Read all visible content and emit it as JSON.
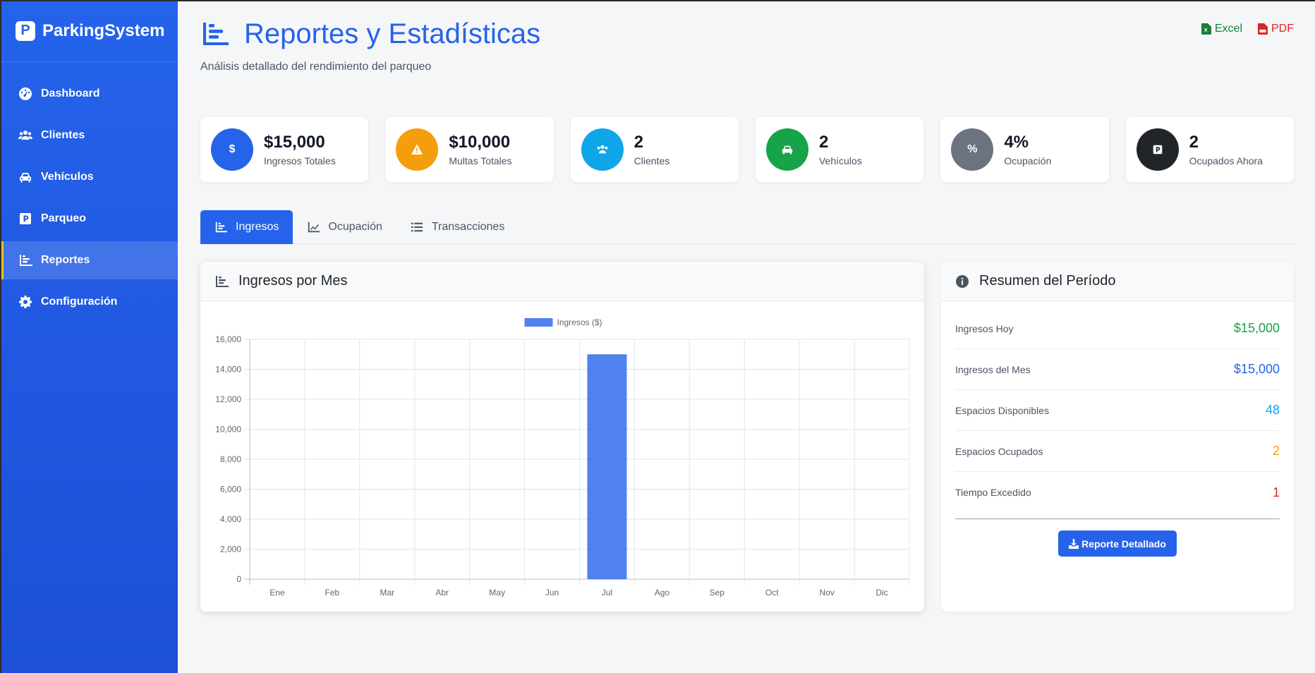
{
  "sidebar": {
    "brand_icon": "P",
    "brand": "ParkingSystem",
    "items": [
      {
        "label": "Dashboard",
        "icon": "tachometer-icon"
      },
      {
        "label": "Clientes",
        "icon": "users-icon"
      },
      {
        "label": "Vehículos",
        "icon": "car-icon"
      },
      {
        "label": "Parqueo",
        "icon": "parking-icon"
      },
      {
        "label": "Reportes",
        "icon": "bar-chart-icon",
        "active": true
      },
      {
        "label": "Configuración",
        "icon": "gear-icon"
      }
    ]
  },
  "header": {
    "title": "Reportes y Estadísticas",
    "subtitle": "Análisis detallado del rendimiento del parqueo",
    "excel_label": "Excel",
    "pdf_label": "PDF"
  },
  "stats": [
    {
      "value": "$15,000",
      "label": "Ingresos Totales",
      "symbol": "$",
      "color": "#2563eb"
    },
    {
      "value": "$10,000",
      "label": "Multas Totales",
      "symbol": "!",
      "color": "#f59e0b"
    },
    {
      "value": "2",
      "label": "Clientes",
      "symbol": "users",
      "color": "#0ea5e9"
    },
    {
      "value": "2",
      "label": "Vehículos",
      "symbol": "car",
      "color": "#16a34a"
    },
    {
      "value": "4%",
      "label": "Ocupación",
      "symbol": "%",
      "color": "#6b7280"
    },
    {
      "value": "2",
      "label": "Ocupados Ahora",
      "symbol": "P",
      "color": "#212529"
    }
  ],
  "tabs": [
    {
      "label": "Ingresos",
      "active": true
    },
    {
      "label": "Ocupación"
    },
    {
      "label": "Transacciones"
    }
  ],
  "chart_panel": {
    "title": "Ingresos por Mes"
  },
  "chart_data": {
    "type": "bar",
    "title": "",
    "legend": "top",
    "series": [
      {
        "name": "Ingresos ($)",
        "color": "#2563eb"
      }
    ],
    "categories": [
      "Ene",
      "Feb",
      "Mar",
      "Abr",
      "May",
      "Jun",
      "Jul",
      "Ago",
      "Sep",
      "Oct",
      "Nov",
      "Dic"
    ],
    "values": [
      0,
      0,
      0,
      0,
      0,
      0,
      15000,
      0,
      0,
      0,
      0,
      0
    ],
    "ylim": [
      0,
      16000
    ],
    "yticks": [
      "0",
      "2,000",
      "4,000",
      "6,000",
      "8,000",
      "10,000",
      "12,000",
      "14,000",
      "16,000"
    ],
    "grid": true
  },
  "summary": {
    "title": "Resumen del Período",
    "rows": [
      {
        "label": "Ingresos Hoy",
        "value": "$15,000",
        "color": "#16a34a"
      },
      {
        "label": "Ingresos del Mes",
        "value": "$15,000",
        "color": "#2563eb"
      },
      {
        "label": "Espacios Disponibles",
        "value": "48",
        "color": "#0ea5e9"
      },
      {
        "label": "Espacios Ocupados",
        "value": "2",
        "color": "#f59e0b"
      },
      {
        "label": "Tiempo Excedido",
        "value": "1",
        "color": "#dc2626"
      }
    ],
    "button_label": "Reporte Detallado"
  }
}
